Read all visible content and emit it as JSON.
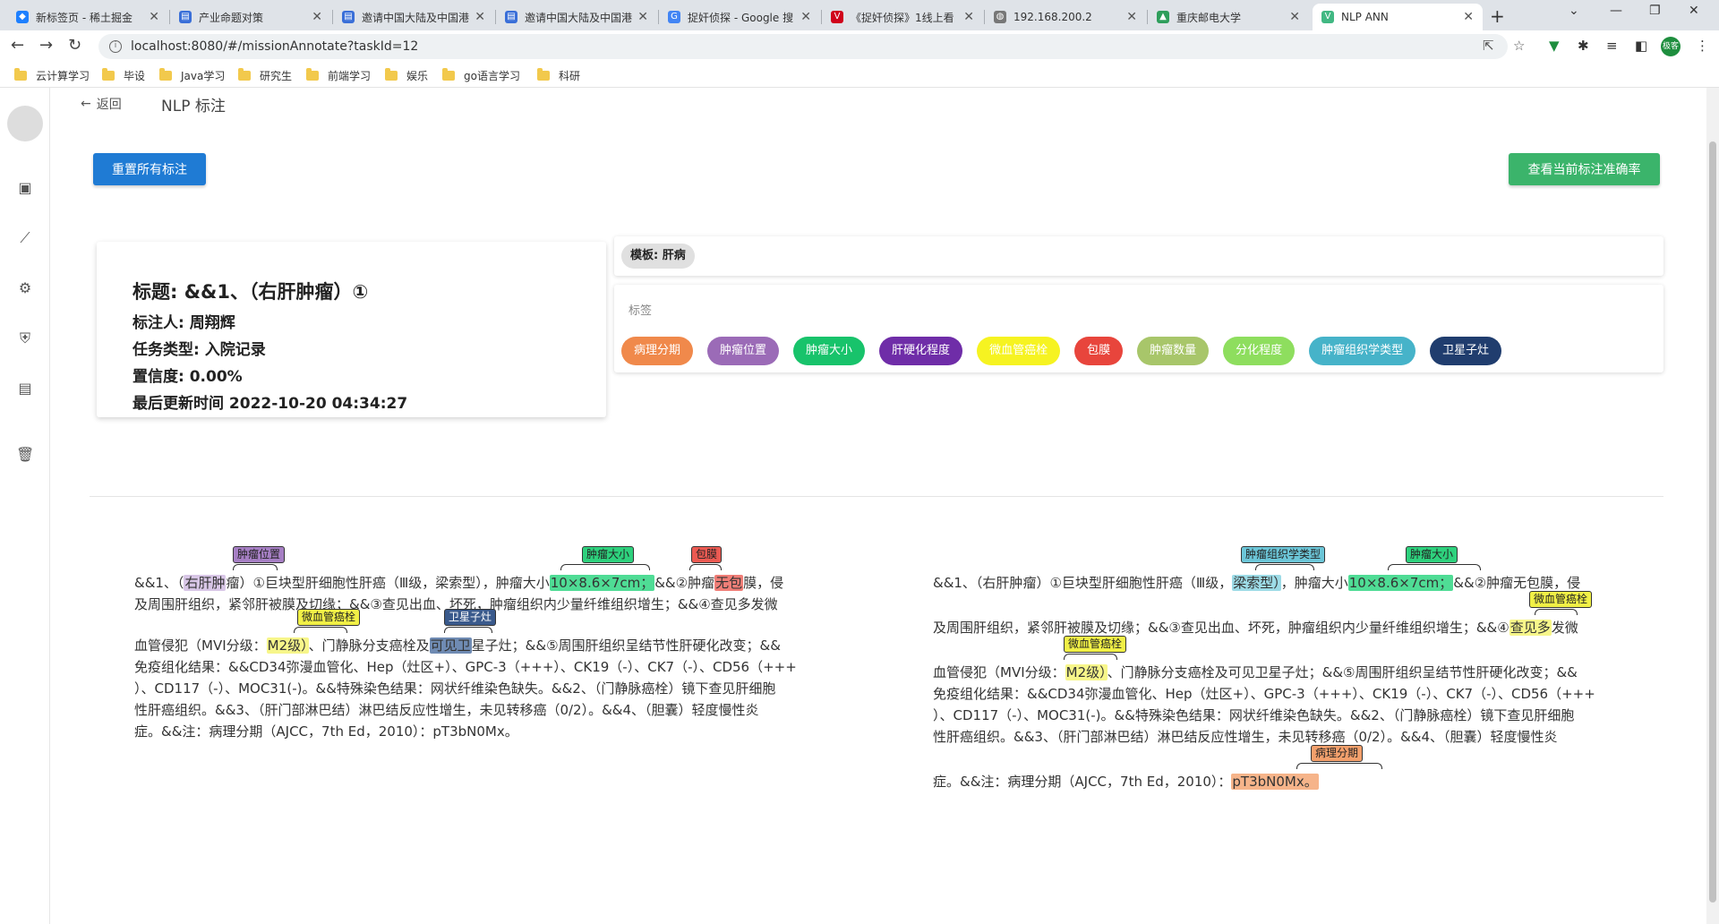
{
  "browser": {
    "tabs": [
      {
        "title": "新标签页 - 稀土掘金",
        "color": "#1e80ff"
      },
      {
        "title": "产业命题对策",
        "color": "#3a6fd8"
      },
      {
        "title": "邀请中国大陆及中国港",
        "color": "#3a6fd8"
      },
      {
        "title": "邀请中国大陆及中国港",
        "color": "#3a6fd8"
      },
      {
        "title": "捉奸侦探 - Google 搜",
        "color": "#4285f4"
      },
      {
        "title": "《捉奸侦探》1线上看",
        "color": "#d0021b"
      },
      {
        "title": "192.168.200.2",
        "color": "#777777"
      },
      {
        "title": "重庆邮电大学",
        "color": "#2e9e5b"
      },
      {
        "title": "NLP ANN",
        "color": "#41b883"
      }
    ],
    "url": "localhost:8080/#/missionAnnotate?taskId=12",
    "bookmarks": [
      "云计算学习",
      "毕设",
      "Java学习",
      "研究生",
      "前端学习",
      "娱乐",
      "go语言学习",
      "科研"
    ],
    "profile": "极客"
  },
  "page": {
    "back_label": "返回",
    "title": "NLP 标注",
    "reset_button": "重置所有标注",
    "accuracy_button": "查看当前标注准确率"
  },
  "info": {
    "title": "标题: &&1、（右肝肿瘤）①",
    "annotator": "标注人: 周翔辉",
    "task_type": "任务类型: 入院记录",
    "confidence": "置信度: 0.00%",
    "updated": "最后更新时间 2022-10-20 04:34:27"
  },
  "template": {
    "label": "模板: 肝病"
  },
  "labels": {
    "title": "标签",
    "items": [
      {
        "name": "病理分期",
        "color": "#f0894b"
      },
      {
        "name": "肿瘤位置",
        "color": "#9b6bb7"
      },
      {
        "name": "肿瘤大小",
        "color": "#18c36b"
      },
      {
        "name": "肝硬化程度",
        "color": "#6f2da8"
      },
      {
        "name": "微血管癌栓",
        "color": "#f6f321"
      },
      {
        "name": "包膜",
        "color": "#e8453c"
      },
      {
        "name": "肿瘤数量",
        "color": "#a8c66a"
      },
      {
        "name": "分化程度",
        "color": "#8ede5e"
      },
      {
        "name": "肿瘤组织学类型",
        "color": "#46b3c9"
      },
      {
        "name": "卫星子灶",
        "color": "#203d6e"
      }
    ]
  },
  "left_panel": {
    "lines": [
      [
        "&&1、（",
        "右肝肿",
        "瘤）①巨块型肝细胞性肝癌（Ⅲ级，梁索型），肿瘤大小",
        "10×8.6×7cm；",
        "&&②肿瘤",
        "无包",
        "膜，侵"
      ],
      [
        "及周围肝组织，紧邻肝被膜及切缘；&&③查见出血、坏死，肿瘤组织内少量纤维组织增生；&&④查见多发微"
      ],
      [
        "血管侵犯（MVI分级：",
        "M2级）",
        "、门静脉分支癌栓及",
        "可见卫",
        "星子灶；&&⑤周围肝组织呈结节性肝硬化改变；&&"
      ],
      [
        "免疫组化结果：&&CD34弥漫血管化、Hep（灶区+）、GPC-3（+++）、CK19（-）、CK7（-）、CD56（+++"
      ],
      [
        "）、CD117（-）、MOC31(-)。&&特殊染色结果：网状纤维染色缺失。&&2、（门静脉癌栓）镜下查见肝细胞"
      ],
      [
        "性肝癌组织。&&3、（肝门部淋巴结）淋巴结反应性增生，未见转移癌（0/2）。&&4、（胆囊）轻度慢性炎"
      ],
      [
        "症。&&注：病理分期（AJCC，7th Ed，2010）：pT3bN0Mx。"
      ]
    ],
    "tags": [
      "肿瘤位置",
      "肿瘤大小",
      "包膜",
      "微血管癌栓",
      "卫星子灶"
    ]
  },
  "right_panel": {
    "lines": [
      [
        "&&1、（右肝肿瘤）①巨块型肝细胞性肝癌（Ⅲ级，",
        "梁索型）",
        "，肿瘤大小",
        "10×8.6×7cm；",
        "&&②肿瘤无包膜，侵"
      ],
      [
        "及周围肝组织，紧邻肝被膜及切缘；&&③查见出血、坏死，肿瘤组织内少量纤维组织增生；&&④",
        "查见多",
        "发微"
      ],
      [
        "血管侵犯（MVI分级：",
        "M2级）",
        "、门静脉分支癌栓及可见卫星子灶；&&⑤周围肝组织呈结节性肝硬化改变；&&"
      ],
      [
        "免疫组化结果：&&CD34弥漫血管化、Hep（灶区+）、GPC-3（+++）、CK19（-）、CK7（-）、CD56（+++"
      ],
      [
        "）、CD117（-）、MOC31(-)。&&特殊染色结果：网状纤维染色缺失。&&2、（门静脉癌栓）镜下查见肝细胞"
      ],
      [
        "性肝癌组织。&&3、（肝门部淋巴结）淋巴结反应性增生，未见转移癌（0/2）。&&4、（胆囊）轻度慢性炎"
      ],
      [
        "症。&&注：病理分期（AJCC，7th Ed，2010）：",
        "pT3bN0Mx。"
      ]
    ],
    "tags": [
      "肿瘤组织学类型",
      "肿瘤大小",
      "微血管癌栓",
      "微血管癌栓",
      "病理分期"
    ]
  }
}
